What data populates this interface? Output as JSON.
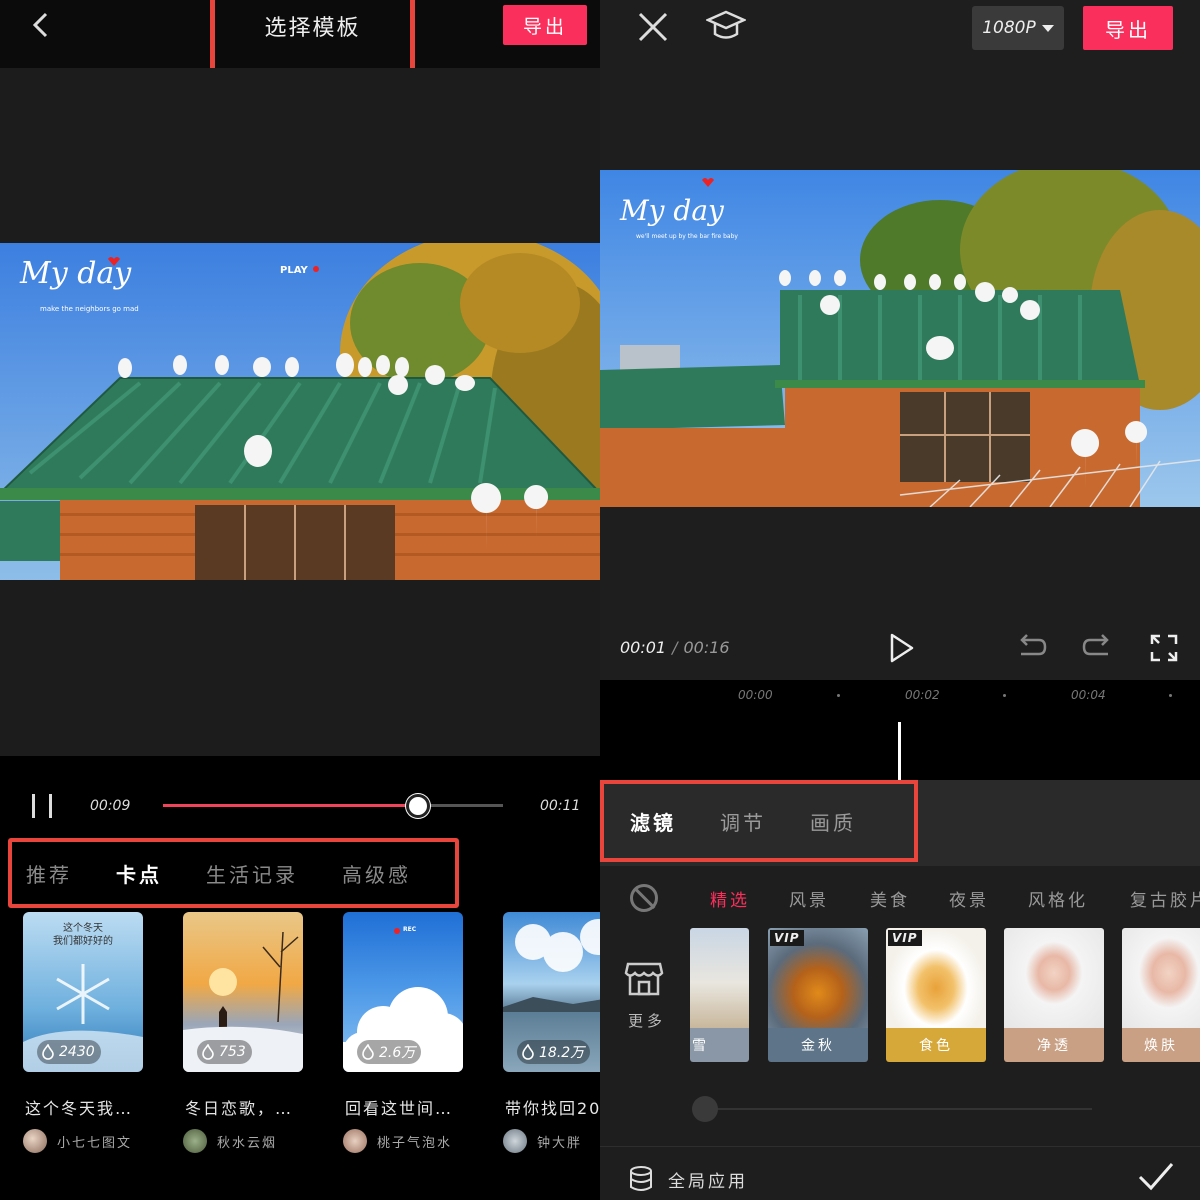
{
  "left": {
    "title": "选择模板",
    "export_label": "导出",
    "icons": {
      "back": "back-chevron-icon",
      "pause": "pause-icon",
      "flame": "flame-icon"
    },
    "preview_overlay": {
      "logo": "My day",
      "tagline": "make the neighbors go mad",
      "play_tag": "PLAY"
    },
    "player": {
      "current_time": "00:09",
      "total_time": "00:11",
      "progress": 0.75
    },
    "category_tabs": [
      {
        "label": "推荐",
        "active": false
      },
      {
        "label": "卡点",
        "active": true
      },
      {
        "label": "生活记录",
        "active": false
      },
      {
        "label": "高级感",
        "active": false
      }
    ],
    "templates": [
      {
        "thumb_text": "这个冬天\n我们都好好的",
        "count": "2430",
        "title": "这个冬天我…",
        "author": "小七七图文"
      },
      {
        "thumb_text": "",
        "count": "753",
        "title": "冬日恋歌，…",
        "author": "秋水云烟"
      },
      {
        "thumb_text": "REC",
        "count": "2.6万",
        "title": "回看这世间…",
        "author": "桃子气泡水"
      },
      {
        "thumb_text": "",
        "count": "18.2万",
        "title": "带你找回20",
        "author": "钟大胖"
      }
    ]
  },
  "right": {
    "resolution": "1080P",
    "export_label": "导出",
    "icons": {
      "close": "close-icon",
      "tutorial": "graduation-cap-icon",
      "play": "play-icon",
      "undo": "undo-icon",
      "redo": "redo-icon",
      "fullscreen": "fullscreen-icon",
      "none": "no-filter-icon",
      "store": "store-icon",
      "layers": "layers-icon",
      "confirm": "checkmark-icon"
    },
    "preview_overlay": {
      "logo": "My day",
      "tagline": "we'll meet up by the bar fire baby"
    },
    "player": {
      "current_time": "00:01",
      "separator": "/",
      "total_time": "00:16"
    },
    "timeline_ticks": [
      "00:00",
      "00:02",
      "00:04"
    ],
    "tabs": [
      {
        "label": "滤镜",
        "active": true
      },
      {
        "label": "调节",
        "active": false
      },
      {
        "label": "画质",
        "active": false
      }
    ],
    "filter_categories": [
      {
        "label": "精选",
        "active": true
      },
      {
        "label": "风景",
        "active": false
      },
      {
        "label": "美食",
        "active": false
      },
      {
        "label": "夜景",
        "active": false
      },
      {
        "label": "风格化",
        "active": false
      },
      {
        "label": "复古胶片",
        "active": false
      }
    ],
    "more_label": "更多",
    "filters": [
      {
        "label": "雪",
        "vip": false,
        "selected": false
      },
      {
        "label": "金秋",
        "vip": true,
        "vip_text": "VIP",
        "selected": false
      },
      {
        "label": "食色",
        "vip": true,
        "vip_text": "VIP",
        "selected": false
      },
      {
        "label": "净透",
        "vip": false,
        "selected": false
      },
      {
        "label": "焕肤",
        "vip": false,
        "selected": false
      }
    ],
    "apply_all_label": "全局应用",
    "colors": {
      "accent": "#fb2f5c",
      "highlight_box": "#e8453c"
    }
  }
}
